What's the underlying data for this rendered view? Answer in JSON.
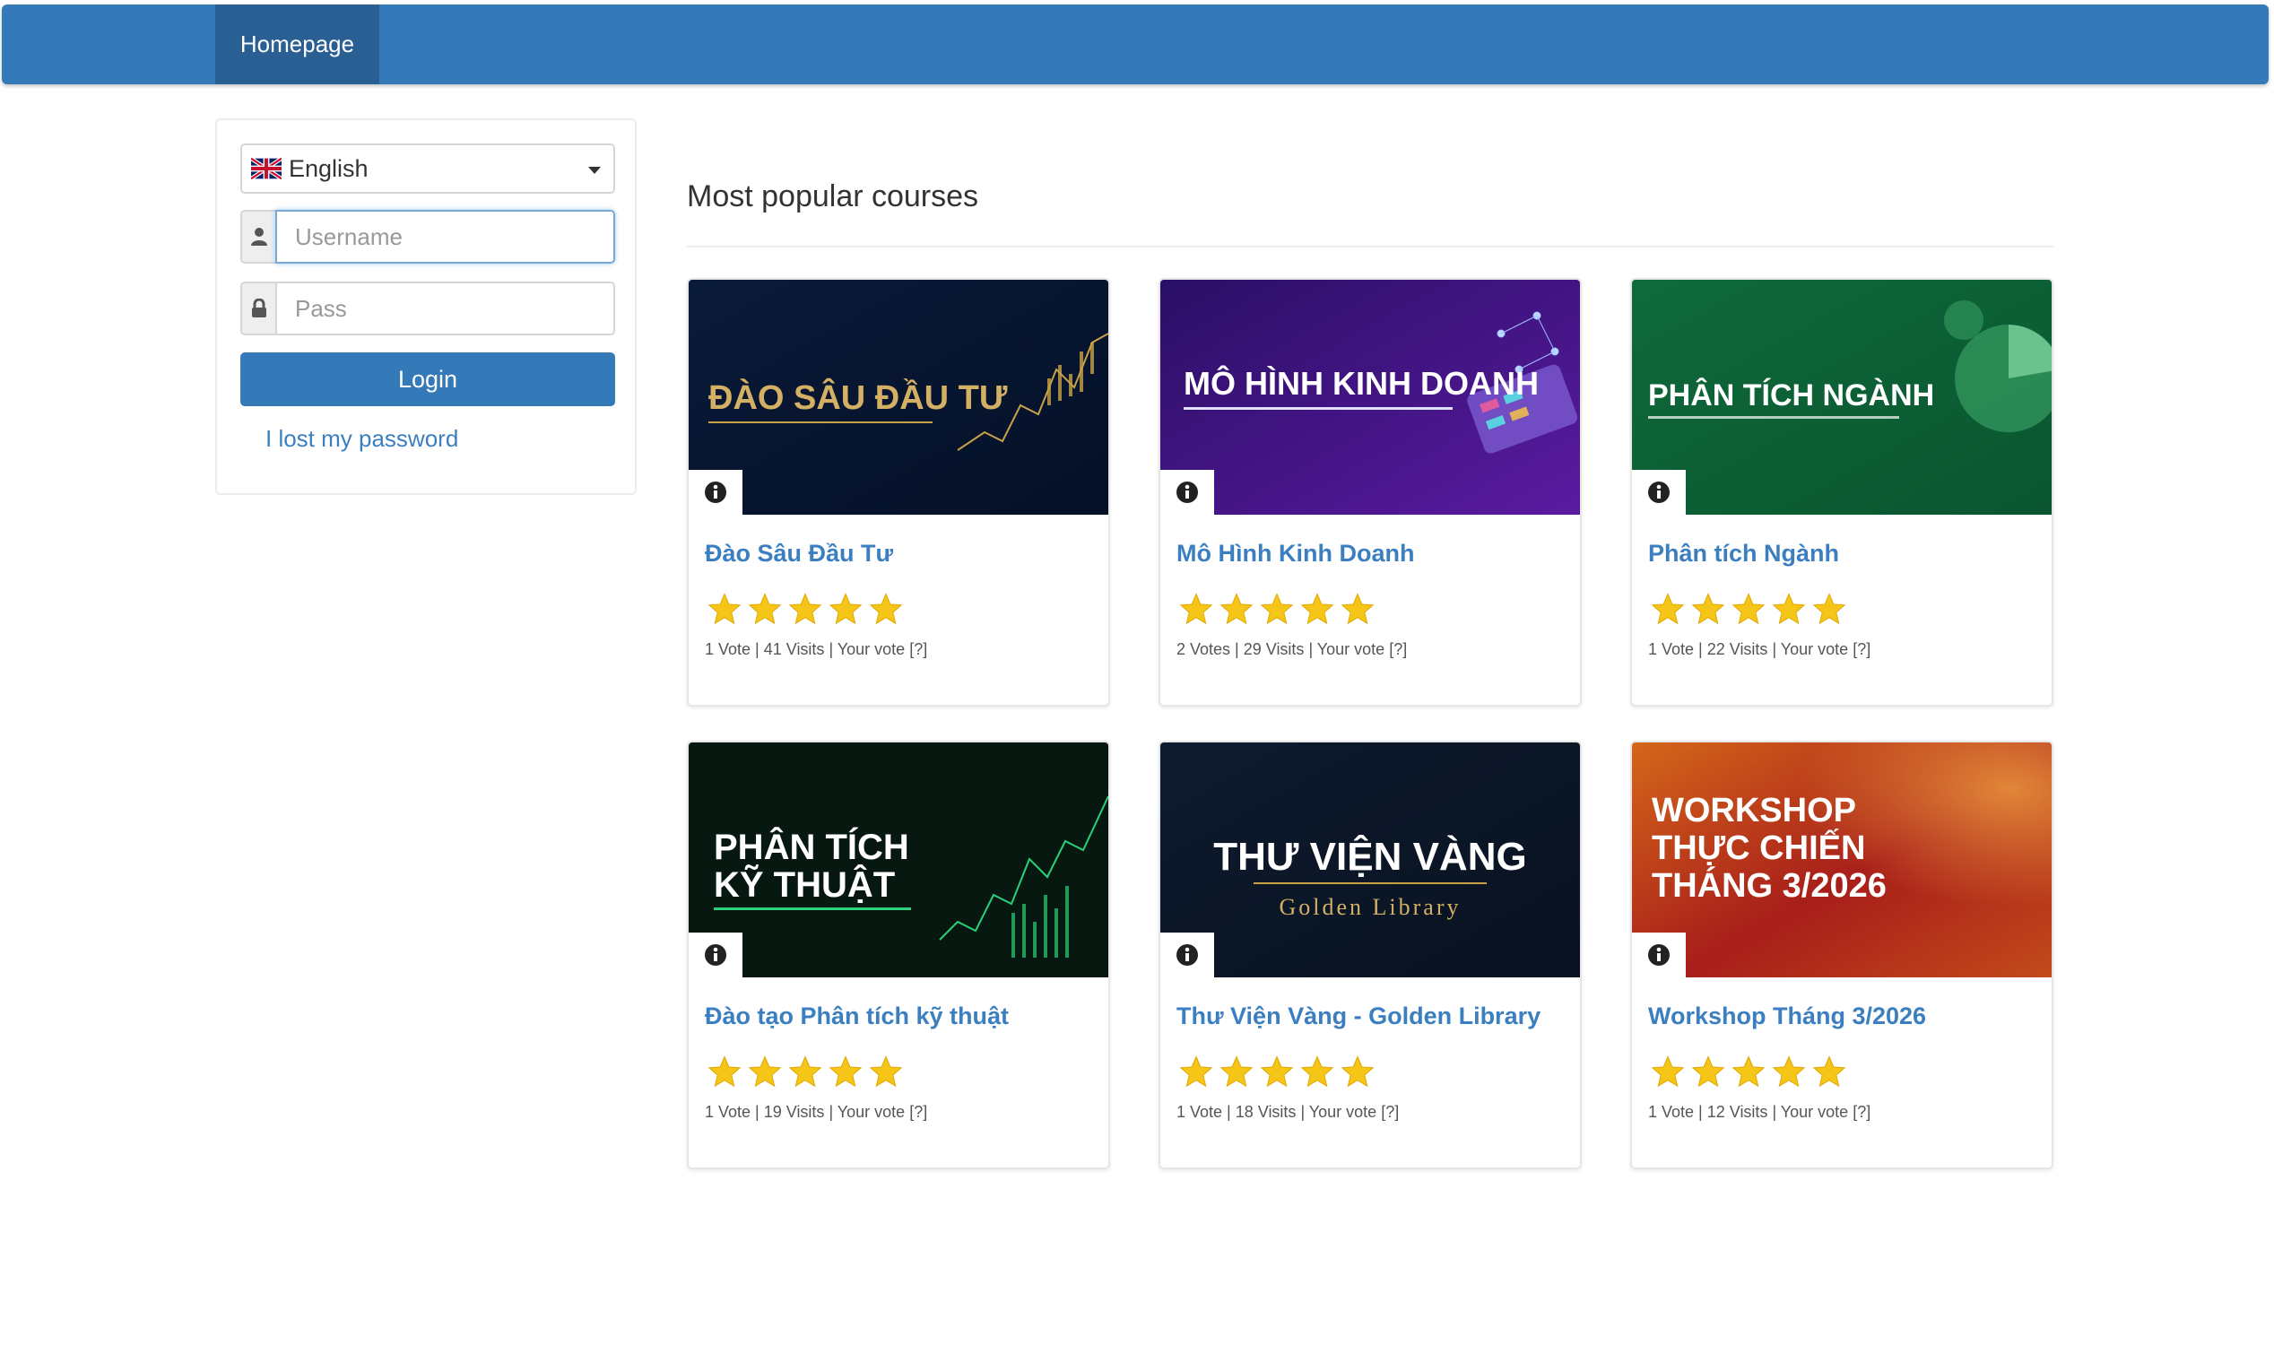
{
  "nav": {
    "home_label": "Homepage"
  },
  "login": {
    "language": "English",
    "username_placeholder": "Username",
    "password_placeholder": "Pass",
    "login_label": "Login",
    "lost_password_label": "I lost my password"
  },
  "section": {
    "title": "Most popular courses"
  },
  "courses": [
    {
      "image_text": "ĐÀO SÂU ĐẦU TƯ",
      "title": "Đào Sâu Đầu Tư",
      "votes": "1 Vote",
      "visits": "41 Visits",
      "your_vote": "Your vote [?]",
      "rating": 5
    },
    {
      "image_text": "MÔ HÌNH KINH DOANH",
      "title": "Mô Hình Kinh Doanh",
      "votes": "2 Votes",
      "visits": "29 Visits",
      "your_vote": "Your vote [?]",
      "rating": 5
    },
    {
      "image_text": "PHÂN TÍCH NGÀNH",
      "title": "Phân tích Ngành",
      "votes": "1 Vote",
      "visits": "22 Visits",
      "your_vote": "Your vote [?]",
      "rating": 5
    },
    {
      "image_text_line1": "PHÂN TÍCH",
      "image_text_line2": "KỸ THUẬT",
      "title": "Đào tạo Phân tích kỹ thuật",
      "votes": "1 Vote",
      "visits": "19 Visits",
      "your_vote": "Your vote [?]",
      "rating": 5
    },
    {
      "image_text": "THƯ VIỆN VÀNG",
      "image_subtext": "Golden Library",
      "title": "Thư Viện Vàng - Golden Library",
      "votes": "1 Vote",
      "visits": "18 Visits",
      "your_vote": "Your vote [?]",
      "rating": 5
    },
    {
      "image_text_line1": "WORKSHOP",
      "image_text_line2": "THỰC CHIẾN",
      "image_text_line3": "THÁNG 3/2026",
      "title": "Workshop Tháng 3/2026",
      "votes": "1 Vote",
      "visits": "12 Visits",
      "your_vote": "Your vote [?]",
      "rating": 5
    }
  ],
  "colors": {
    "brand": "#357ab8",
    "link": "#3b7fc0",
    "star": "#f5c518"
  }
}
